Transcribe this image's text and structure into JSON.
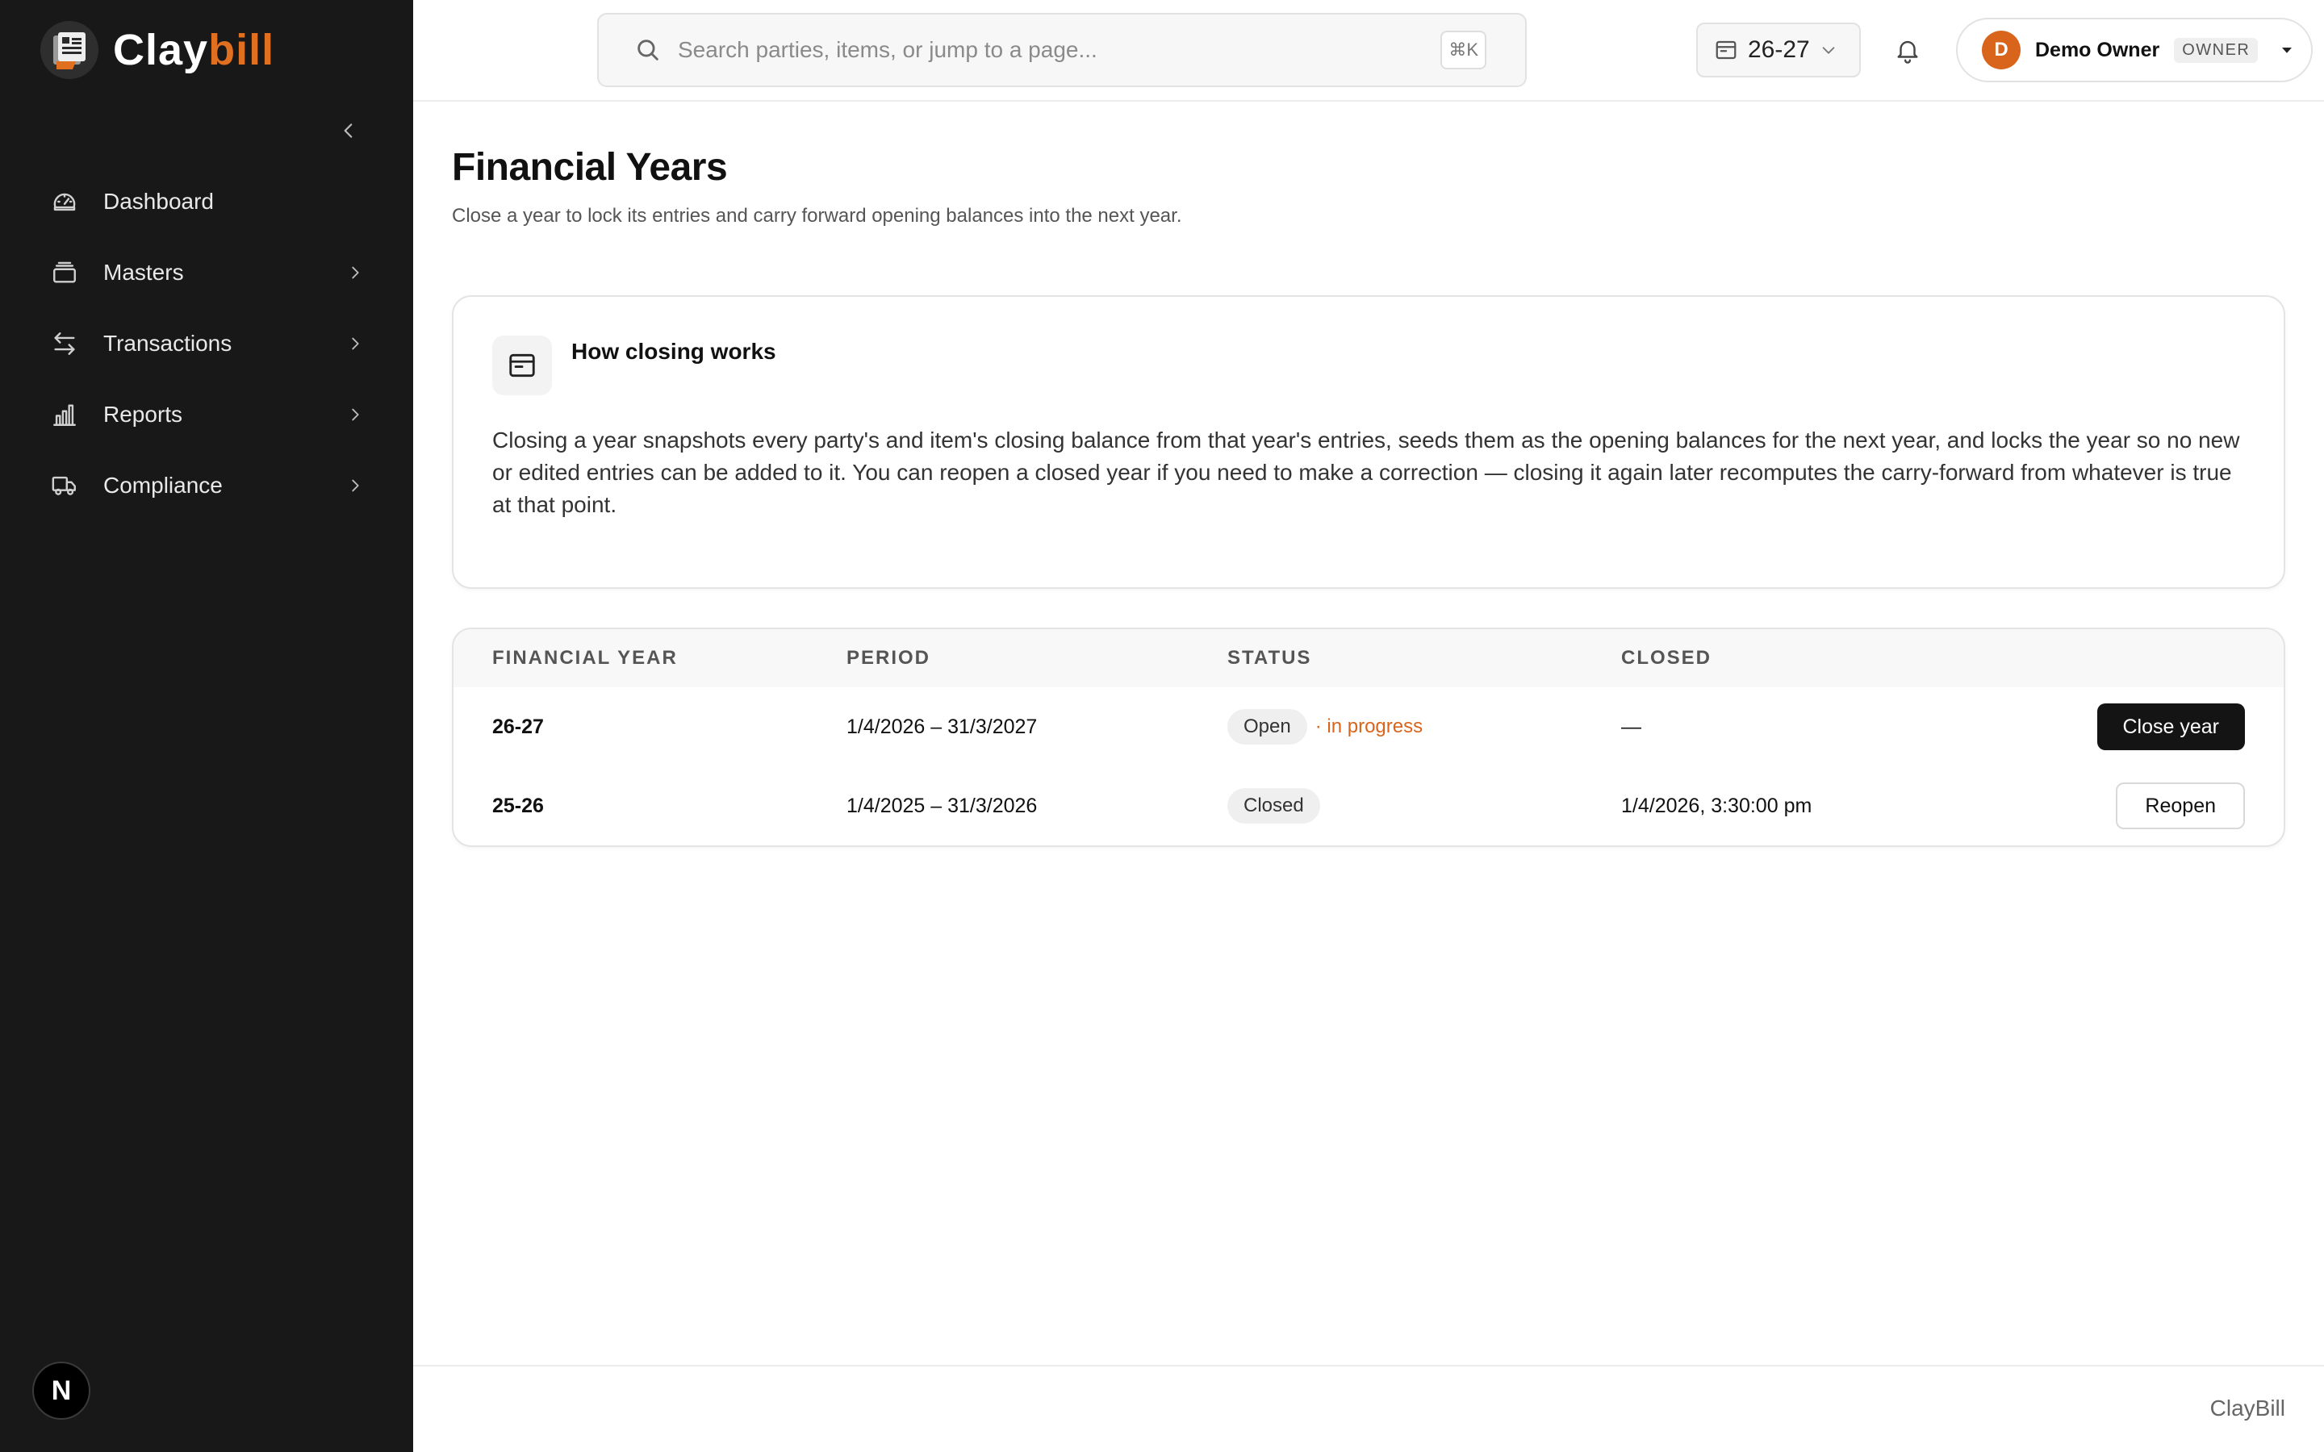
{
  "brand": {
    "name_main": "Clay",
    "name_accent": "bill",
    "accent_color": "#e07020"
  },
  "sidebar": {
    "items": [
      {
        "label": "Dashboard",
        "icon": "gauge-icon",
        "has_children": false
      },
      {
        "label": "Masters",
        "icon": "stack-icon",
        "has_children": true
      },
      {
        "label": "Transactions",
        "icon": "arrows-swap-icon",
        "has_children": true
      },
      {
        "label": "Reports",
        "icon": "bar-chart-icon",
        "has_children": true
      },
      {
        "label": "Compliance",
        "icon": "truck-icon",
        "has_children": true
      }
    ],
    "bottom_badge": "N"
  },
  "topbar": {
    "search_placeholder": "Search parties, items, or jump to a page...",
    "search_shortcut": "⌘K",
    "fy_selected": "26-27",
    "user": {
      "initial": "D",
      "name": "Demo Owner",
      "role": "OWNER",
      "avatar_color": "#d9651c"
    }
  },
  "page": {
    "title": "Financial Years",
    "subtitle": "Close a year to lock its entries and carry forward opening balances into the next year."
  },
  "info_card": {
    "title": "How closing works",
    "body": "Closing a year snapshots every party's and item's closing balance from that year's entries, seeds them as the opening balances for the next year, and locks the year so no new or edited entries can be added to it. You can reopen a closed year if you need to make a correction — closing it again later recomputes the carry-forward from whatever is true at that point."
  },
  "table": {
    "headers": {
      "fy": "FINANCIAL YEAR",
      "period": "PERIOD",
      "status": "STATUS",
      "closed": "CLOSED"
    },
    "rows": [
      {
        "fy": "26-27",
        "period": "1/4/2026 – 31/3/2027",
        "status": "Open",
        "status_note": "· in progress",
        "closed": "—",
        "action": "Close year"
      },
      {
        "fy": "25-26",
        "period": "1/4/2025 – 31/3/2026",
        "status": "Closed",
        "status_note": "",
        "closed": "1/4/2026, 3:30:00 pm",
        "action": "Reopen"
      }
    ]
  },
  "footer": {
    "text": "ClayBill"
  }
}
